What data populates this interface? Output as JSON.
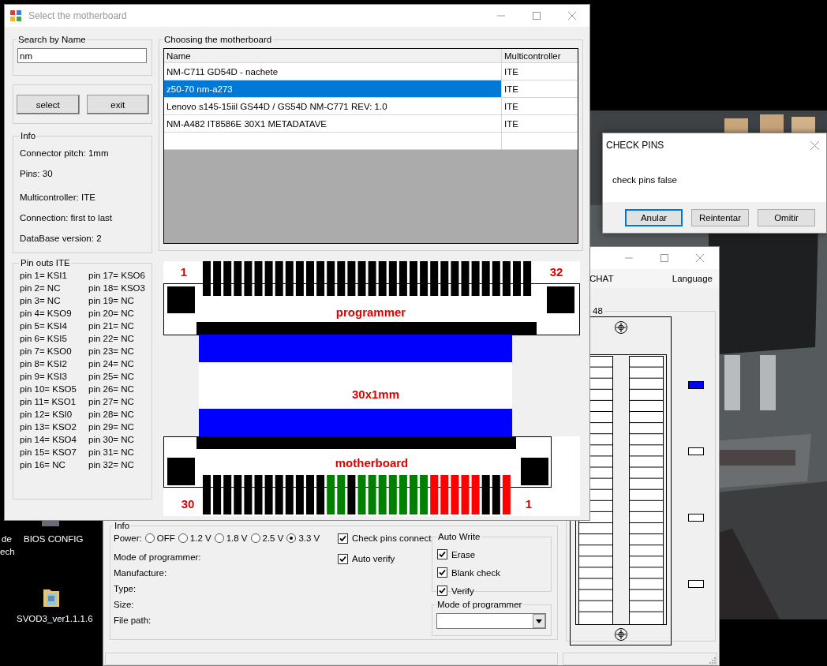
{
  "desktop": {
    "edge_texts": [
      "de",
      "ech"
    ],
    "icons": [
      {
        "label": "BIOS CONFIG",
        "kind": "app"
      },
      {
        "label": "SVOD3_ver1.1.1.6",
        "kind": "folder"
      }
    ]
  },
  "main_window": {
    "menu": [
      "CHAT",
      "Language"
    ],
    "info_title": "Info",
    "power": {
      "label": "Power:",
      "options": [
        {
          "label": "OFF",
          "selected": false
        },
        {
          "label": "1.2 V",
          "selected": false
        },
        {
          "label": "1.8 V",
          "selected": false
        },
        {
          "label": "2.5 V",
          "selected": false
        },
        {
          "label": "3.3 V",
          "selected": true
        }
      ]
    },
    "options": [
      {
        "label": "Check pins connect",
        "checked": true
      },
      {
        "label": "Auto verify",
        "checked": true
      }
    ],
    "fields": [
      "Mode of programmer:",
      "Manufacture:",
      "Type:",
      "Size:",
      "File path:"
    ],
    "auto_write": {
      "title": "Auto Write",
      "items": [
        {
          "label": "Erase",
          "checked": true
        },
        {
          "label": "Blank check",
          "checked": true
        },
        {
          "label": "Verify",
          "checked": true
        }
      ]
    },
    "mode": {
      "title": "Mode of programmer"
    },
    "socket_title": "48",
    "leds": [
      {
        "on": true
      },
      {
        "on": false
      },
      {
        "on": false
      },
      {
        "on": false
      }
    ]
  },
  "check_pins_dialog": {
    "title": "CHECK PINS",
    "message": "check pins false",
    "buttons": [
      {
        "label": "Anular",
        "default": true
      },
      {
        "label": "Reintentar",
        "default": false
      },
      {
        "label": "Omitir",
        "default": false
      }
    ]
  },
  "select_dialog": {
    "title": "Select the motherboard",
    "search": {
      "title": "Search by Name",
      "value": "nm"
    },
    "buttons": [
      "select",
      "exit"
    ],
    "info": {
      "title": "Info",
      "lines": [
        "Connector pitch: 1mm",
        "Pins: 30",
        "Multicontroller: ITE",
        "Connection: first to last",
        "DataBase version: 2"
      ]
    },
    "pinouts": {
      "title": "Pin outs ITE",
      "pins": [
        "pin 1= KSI1",
        "pin 2= NC",
        "pin 3= NC",
        "pin 4= KSO9",
        "pin 5= KSI4",
        "pin 6= KSI5",
        "pin 7= KSO0",
        "pin 8= KSI2",
        "pin 9= KSI3",
        "pin 10= KSO5",
        "pin 11= KSO1",
        "pin 12= KSI0",
        "pin 13= KSO2",
        "pin 14= KSO4",
        "pin 15= KSO7",
        "pin 16= NC",
        "pin 17= KSO6",
        "pin 18= KSO3",
        "pin 19= NC",
        "pin 20= NC",
        "pin 21= NC",
        "pin 22= NC",
        "pin 23= NC",
        "pin 24= NC",
        "pin 25= NC",
        "pin 26= NC",
        "pin 27= NC",
        "pin 28= NC",
        "pin 29= NC",
        "pin 30= NC",
        "pin 31= NC",
        "pin 32= NC"
      ]
    },
    "table": {
      "title": "Choosing the motherboard",
      "columns": [
        "Name",
        "Multicontroller"
      ],
      "rows": [
        {
          "cells": [
            "NM-C711 GD54D - nachete",
            "ITE"
          ],
          "selected": false
        },
        {
          "cells": [
            "z50-70 nm-a273",
            "ITE"
          ],
          "selected": true
        },
        {
          "cells": [
            "Lenovo s145-15iil GS44D / GS54D NM-C771 REV: 1.0",
            "ITE"
          ],
          "selected": false
        },
        {
          "cells": [
            "NM-A482 IT8586E 30X1 METADATAVE",
            "ITE"
          ],
          "selected": false
        }
      ]
    },
    "connector": {
      "top_left_number": "1",
      "top_right_number": "32",
      "programmer_label": "programmer",
      "cable_label": "30x1mm",
      "motherboard_label": "motherboard",
      "bottom_left_number": "30",
      "bottom_right_number": "1",
      "top_pins": [
        {
          "color": "#000000"
        },
        {
          "color": "#000000"
        },
        {
          "color": "#000000"
        },
        {
          "color": "#000000"
        },
        {
          "color": "#000000"
        },
        {
          "color": "#000000"
        },
        {
          "color": "#000000"
        },
        {
          "color": "#000000"
        },
        {
          "color": "#000000"
        },
        {
          "color": "#000000"
        },
        {
          "color": "#000000"
        },
        {
          "color": "#000000"
        },
        {
          "color": "#000000"
        },
        {
          "color": "#000000"
        },
        {
          "color": "#000000"
        },
        {
          "color": "#000000"
        },
        {
          "color": "#000000"
        },
        {
          "color": "#000000"
        },
        {
          "color": "#000000"
        },
        {
          "color": "#000000"
        },
        {
          "color": "#000000"
        },
        {
          "color": "#000000"
        },
        {
          "color": "#000000"
        },
        {
          "color": "#000000"
        },
        {
          "color": "#000000"
        },
        {
          "color": "#000000"
        },
        {
          "color": "#000000"
        },
        {
          "color": "#000000"
        },
        {
          "color": "#000000"
        },
        {
          "color": "#000000"
        },
        {
          "color": "#000000"
        },
        {
          "color": "#000000"
        }
      ],
      "bottom_pins": [
        {
          "color": "#000000"
        },
        {
          "color": "#000000"
        },
        {
          "color": "#000000"
        },
        {
          "color": "#000000"
        },
        {
          "color": "#000000"
        },
        {
          "color": "#000000"
        },
        {
          "color": "#000000"
        },
        {
          "color": "#000000"
        },
        {
          "color": "#000000"
        },
        {
          "color": "#000000"
        },
        {
          "color": "#000000"
        },
        {
          "color": "#000000"
        },
        {
          "color": "#008000"
        },
        {
          "color": "#008000"
        },
        {
          "color": "#000000"
        },
        {
          "color": "#008000"
        },
        {
          "color": "#008000"
        },
        {
          "color": "#008000"
        },
        {
          "color": "#008000"
        },
        {
          "color": "#008000"
        },
        {
          "color": "#008000"
        },
        {
          "color": "#008000"
        },
        {
          "color": "#ff0000"
        },
        {
          "color": "#ff0000"
        },
        {
          "color": "#ff0000"
        },
        {
          "color": "#ff0000"
        },
        {
          "color": "#ff0000"
        },
        {
          "color": "#000000"
        },
        {
          "color": "#000000"
        },
        {
          "color": "#ff0000"
        }
      ]
    }
  }
}
